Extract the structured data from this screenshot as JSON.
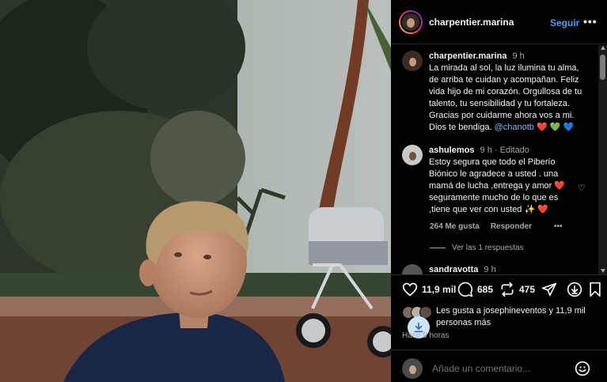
{
  "header": {
    "username": "charpentier.marina",
    "follow_label": "Seguir",
    "more_label": "•••"
  },
  "caption": {
    "username": "charpentier.marina",
    "time": "9 h",
    "text": "La mirada al sol, la luz ilumina tu alma, de arriba te cuidan y acompañan.  Feliz vida hijo de mi corazón. Orgullosa de tu talento, tu sensibilidad y tu fortaleza. Gracias por cuidarme ahora vos a mi. Dios te bendiga.",
    "mention": "@chanotb",
    "emojis": "❤️ 💚 💙"
  },
  "comment1": {
    "username": "ashulemos",
    "time": "9 h",
    "edited": "· Editado",
    "text": "Estoy segura que todo el Piberío Biónico le agradece a usted . una mamá de lucha ,entrega y amor ❤️ seguramente mucho de lo que es ,tiene que ver con usted ✨ ❤️",
    "likes": "264 Me gusta",
    "reply_label": "Responder",
    "more_label": "•••",
    "view_replies": "Ver las 1 respuestas"
  },
  "comment2": {
    "username": "sandravotta",
    "time": "9 h"
  },
  "actions": {
    "like_count": "11,9 mil",
    "comment_count": "685",
    "repost_count": "475"
  },
  "likes_summary": {
    "text": "Les gusta a josephineventos y 11,9 mil personas más"
  },
  "timestamp": "Hace 9 horas",
  "add_comment": {
    "placeholder": "Añade un comentario..."
  },
  "colors": {
    "link": "#4a9df8",
    "background": "#000000"
  }
}
